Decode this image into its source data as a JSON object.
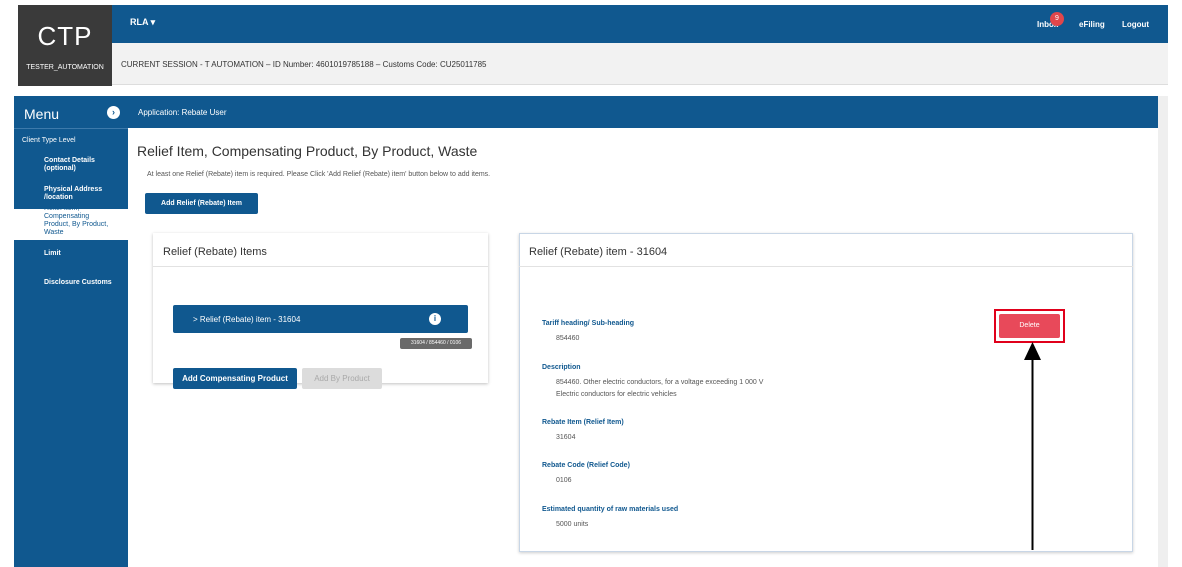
{
  "header": {
    "logo_title": "CTP",
    "logo_user": "TESTER_AUTOMATION",
    "app_switch": "RLA ▾",
    "session": "CURRENT SESSION - T AUTOMATION – ID Number: 4601019785188 – Customs Code: CU25011785",
    "inbox": "Inbox",
    "inbox_count": "9",
    "efiling": "eFiling",
    "logout": "Logout"
  },
  "sidebar": {
    "title": "Menu",
    "toggle_icon": "›",
    "section": "Client Type Level",
    "items": [
      {
        "label": "Contact Details (optional)"
      },
      {
        "label": "Physical Address /location"
      },
      {
        "label": "Relief Item, Compensating Product, By Product, Waste"
      },
      {
        "label": "Limit"
      },
      {
        "label": "Disclosure Customs"
      }
    ]
  },
  "appbar": {
    "text": "Application: Rebate User"
  },
  "main": {
    "title": "Relief Item, Compensating Product, By Product, Waste",
    "hint": "At least one Relief (Rebate) item is required. Please Click 'Add Relief (Rebate) item' button below to add items.",
    "add_button": "Add Relief (Rebate) Item"
  },
  "left_card": {
    "title": "Relief (Rebate) Items",
    "item_label": "> Relief (Rebate) item - 31604",
    "info_icon": "i",
    "tooltip": "31604 / 854460 / 0106",
    "add_comp": "Add Compensating Product",
    "add_byproduct": "Add By Product"
  },
  "right_card": {
    "title": "Relief (Rebate) item - 31604",
    "delete_label": "Delete",
    "fields": [
      {
        "label": "Tariff heading/ Sub-heading",
        "value": "854460"
      },
      {
        "label": "Description",
        "value": "854460. Other electric conductors, for a voltage exceeding 1 000 V",
        "value2": "Electric conductors for electric vehicles"
      },
      {
        "label": "Rebate Item (Relief Item)",
        "value": "31604"
      },
      {
        "label": "Rebate Code (Relief Code)",
        "value": "0106"
      },
      {
        "label": "Estimated quantity of raw materials used",
        "value": "5000 units"
      }
    ]
  }
}
